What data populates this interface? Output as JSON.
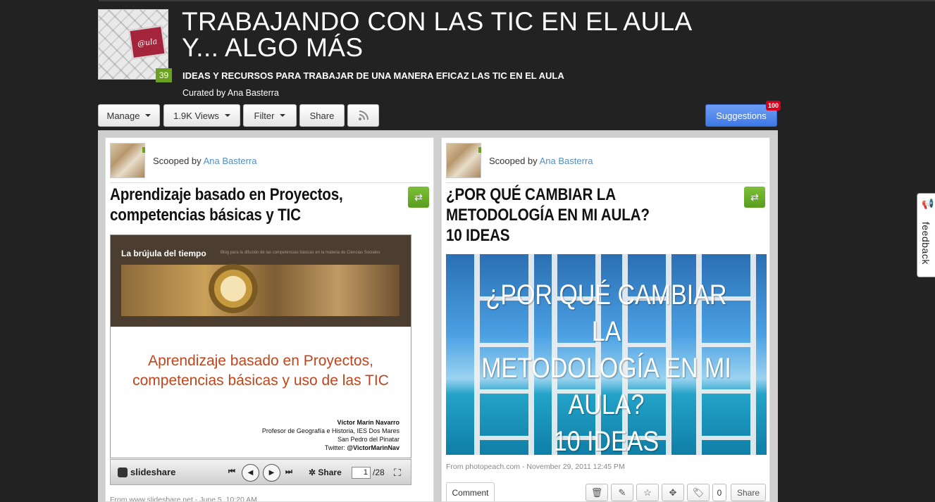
{
  "header": {
    "title_line1": "TRABAJANDO CON LAS TIC EN EL AULA",
    "title_line2": "Y... ALGO MÁS",
    "subtitle": "IDEAS Y RECURSOS PARA TRABAJAR DE UNA MANERA EFICAZ LAS TIC EN EL AULA",
    "curated_by": "Curated by Ana Basterra",
    "logo_text": "@ula",
    "logo_badge": "39"
  },
  "toolbar": {
    "manage": "Manage",
    "views": "1.9K Views",
    "filter": "Filter",
    "share": "Share",
    "suggestions": "Suggestions",
    "suggestions_badge": "100"
  },
  "posts": [
    {
      "scooped_prefix": "Scooped by",
      "author": "Ana Basterra",
      "title": "Aprendizaje basado en Proyectos, competencias básicas y TIC",
      "embed": {
        "blog_name": "La brújula del tiempo",
        "blog_desc": "Blog para la difusión de las competencias básicas en la materia de Ciencias Sociales",
        "slide_title": "Aprendizaje basado en Proyectos, competencias básicas y uso de las TIC",
        "author_name": "Víctor Marín Navarro",
        "author_line2": "Profesor de Geografía e Historia, IES Dos Mares",
        "author_line3": "San Pedro del Pinatar",
        "author_twitter_prefix": "Twitter: ",
        "author_twitter": "@VictorMarinNav",
        "player_brand": "slideshare",
        "player_share": "Share",
        "current_page": "1",
        "total_pages": "/28"
      },
      "source": "From www.slideshare.net - June 5, 10:20 AM"
    },
    {
      "scooped_prefix": "Scooped by",
      "author": "Ana Basterra",
      "title": "¿POR QUÉ CAMBIAR LA METODOLOGÍA EN MI AULA? 10 IDEAS",
      "image_text_1": "¿POR QUÉ CAMBIAR LA",
      "image_text_2": "METODOLOGÍA EN MI",
      "image_text_3": "AULA?",
      "image_text_4": "10 IDEAS",
      "source": "From photopeach.com - November 29, 2011 12:45 PM",
      "comment_label": "Comment",
      "tag_count": "0",
      "share_label": "Share"
    }
  ],
  "feedback_label": "feedback",
  "colors": {
    "background": "#222222",
    "accent_green": "#6aa121",
    "link_blue": "#4f8fc9",
    "suggestions_blue": "#4a82ea",
    "badge_red": "#d8001c"
  }
}
